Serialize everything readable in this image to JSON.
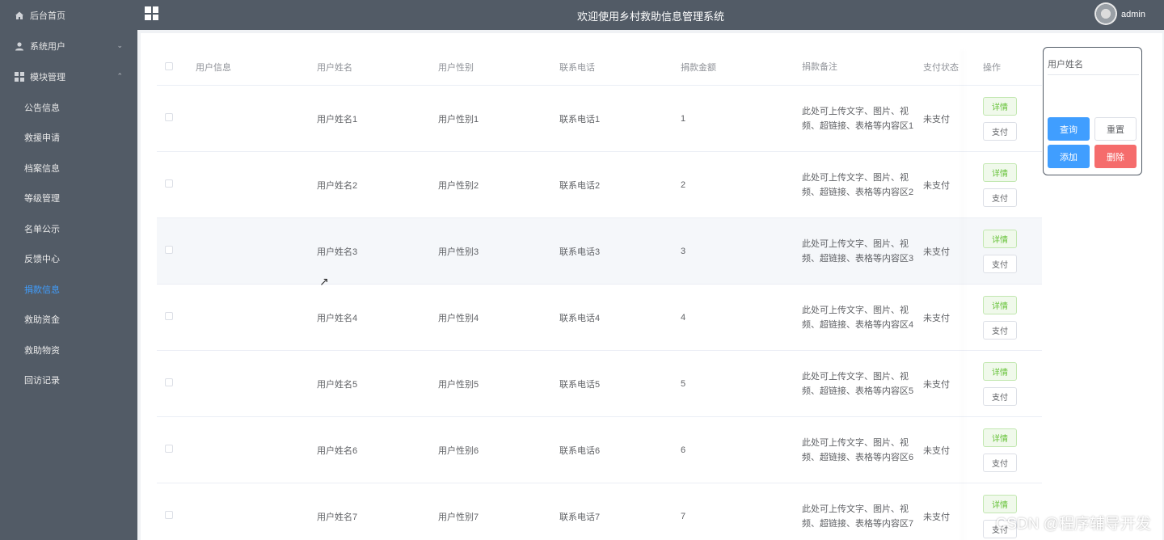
{
  "sidebar": {
    "home": "后台首页",
    "system_users": "系统用户",
    "module_mgmt": "模块管理",
    "items": [
      {
        "label": "公告信息",
        "active": false
      },
      {
        "label": "救援申请",
        "active": false
      },
      {
        "label": "档案信息",
        "active": false
      },
      {
        "label": "等级管理",
        "active": false
      },
      {
        "label": "名单公示",
        "active": false
      },
      {
        "label": "反馈中心",
        "active": false
      },
      {
        "label": "捐款信息",
        "active": true
      },
      {
        "label": "救助资金",
        "active": false
      },
      {
        "label": "救助物资",
        "active": false
      },
      {
        "label": "回访记录",
        "active": false
      }
    ]
  },
  "header": {
    "title": "欢迎使用乡村救助信息管理系统",
    "user": "admin"
  },
  "table": {
    "columns": [
      "用户信息",
      "用户姓名",
      "用户性别",
      "联系电话",
      "捐款金额",
      "捐款备注",
      "支付状态",
      "操作"
    ],
    "detail_label": "详情",
    "pay_label": "支付",
    "rows": [
      {
        "name": "用户姓名1",
        "gender": "用户性别1",
        "phone": "联系电话1",
        "amount": "1",
        "remark": "此处可上传文字、图片、视频、超链接、表格等内容区1",
        "status": "未支付"
      },
      {
        "name": "用户姓名2",
        "gender": "用户性别2",
        "phone": "联系电话2",
        "amount": "2",
        "remark": "此处可上传文字、图片、视频、超链接、表格等内容区2",
        "status": "未支付"
      },
      {
        "name": "用户姓名3",
        "gender": "用户性别3",
        "phone": "联系电话3",
        "amount": "3",
        "remark": "此处可上传文字、图片、视频、超链接、表格等内容区3",
        "status": "未支付"
      },
      {
        "name": "用户姓名4",
        "gender": "用户性别4",
        "phone": "联系电话4",
        "amount": "4",
        "remark": "此处可上传文字、图片、视频、超链接、表格等内容区4",
        "status": "未支付"
      },
      {
        "name": "用户姓名5",
        "gender": "用户性别5",
        "phone": "联系电话5",
        "amount": "5",
        "remark": "此处可上传文字、图片、视频、超链接、表格等内容区5",
        "status": "未支付"
      },
      {
        "name": "用户姓名6",
        "gender": "用户性别6",
        "phone": "联系电话6",
        "amount": "6",
        "remark": "此处可上传文字、图片、视频、超链接、表格等内容区6",
        "status": "未支付"
      },
      {
        "name": "用户姓名7",
        "gender": "用户性别7",
        "phone": "联系电话7",
        "amount": "7",
        "remark": "此处可上传文字、图片、视频、超链接、表格等内容区7",
        "status": "未支付"
      }
    ]
  },
  "search": {
    "label": "用户姓名",
    "value": "",
    "query": "查询",
    "reset": "重置",
    "add": "添加",
    "delete": "删除"
  },
  "watermark": "CSDN @程序辅导开发",
  "colors": {
    "primary": "#409eff",
    "danger": "#f56c6c",
    "success": "#67c23a",
    "sidebar": "#525b66"
  }
}
